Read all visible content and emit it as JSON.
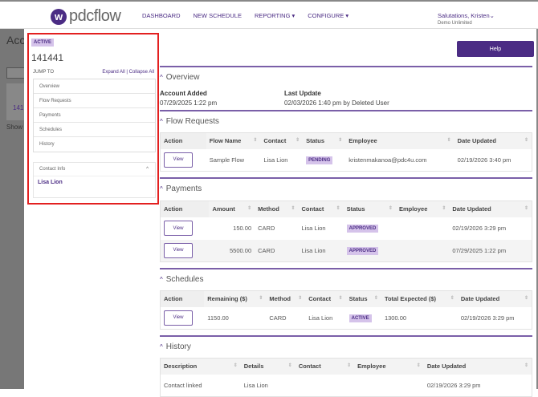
{
  "header": {
    "logo": "pdcflow",
    "nav": [
      "DASHBOARD",
      "NEW SCHEDULE",
      "REPORTING",
      "CONFIGURE"
    ],
    "user": "Salutations, Kristen",
    "org": "Demo Unlimited"
  },
  "backdrop": {
    "title": "Acc",
    "row": "141",
    "show": "Show"
  },
  "side": {
    "status": "ACTIVE",
    "account": "141441",
    "jump_to": "JUMP TO",
    "expand": "Expand All",
    "collapse": "Collapse All",
    "jump_items": [
      "Overview",
      "Flow Requests",
      "Payments",
      "Schedules",
      "History"
    ],
    "contact_info": "Contact Info",
    "contact_name": "Lisa Lion"
  },
  "help": "Help",
  "overview": {
    "title": "Overview",
    "added_label": "Account Added",
    "added": "07/29/2025 1:22 pm",
    "update_label": "Last Update",
    "update": "02/03/2026 1:40 pm by Deleted User"
  },
  "tables": {
    "flow": {
      "title": "Flow Requests",
      "cols": [
        "Action",
        "Flow Name",
        "Contact",
        "Status",
        "Employee",
        "Date Updated"
      ],
      "rows": [
        [
          "View",
          "Sample Flow",
          "Lisa Lion",
          "PENDING",
          "kristenmakanoa@pdc4u.com",
          "02/19/2026 3:40 pm"
        ]
      ]
    },
    "payments": {
      "title": "Payments",
      "cols": [
        "Action",
        "Amount",
        "Method",
        "Contact",
        "Status",
        "Employee",
        "Date Updated"
      ],
      "rows": [
        [
          "View",
          "150.00",
          "CARD",
          "Lisa Lion",
          "APPROVED",
          "",
          "02/19/2026 3:29 pm"
        ],
        [
          "View",
          "5500.00",
          "CARD",
          "Lisa Lion",
          "APPROVED",
          "",
          "07/29/2025 1:22 pm"
        ]
      ]
    },
    "schedules": {
      "title": "Schedules",
      "cols": [
        "Action",
        "Remaining ($)",
        "Method",
        "Contact",
        "Status",
        "Total Expected ($)",
        "Date Updated"
      ],
      "rows": [
        [
          "View",
          "1150.00",
          "CARD",
          "Lisa Lion",
          "ACTIVE",
          "1300.00",
          "02/19/2026 3:29 pm"
        ]
      ]
    },
    "history": {
      "title": "History",
      "cols": [
        "Description",
        "Details",
        "Contact",
        "Employee",
        "Date Updated"
      ],
      "rows": [
        [
          "Contact linked",
          "Lisa Lion",
          "",
          "",
          "02/19/2026 3:29 pm"
        ]
      ]
    }
  },
  "colors": {
    "brand": "#4b2c84",
    "badge": "#d5c3ea",
    "highlight": "#e32020"
  }
}
